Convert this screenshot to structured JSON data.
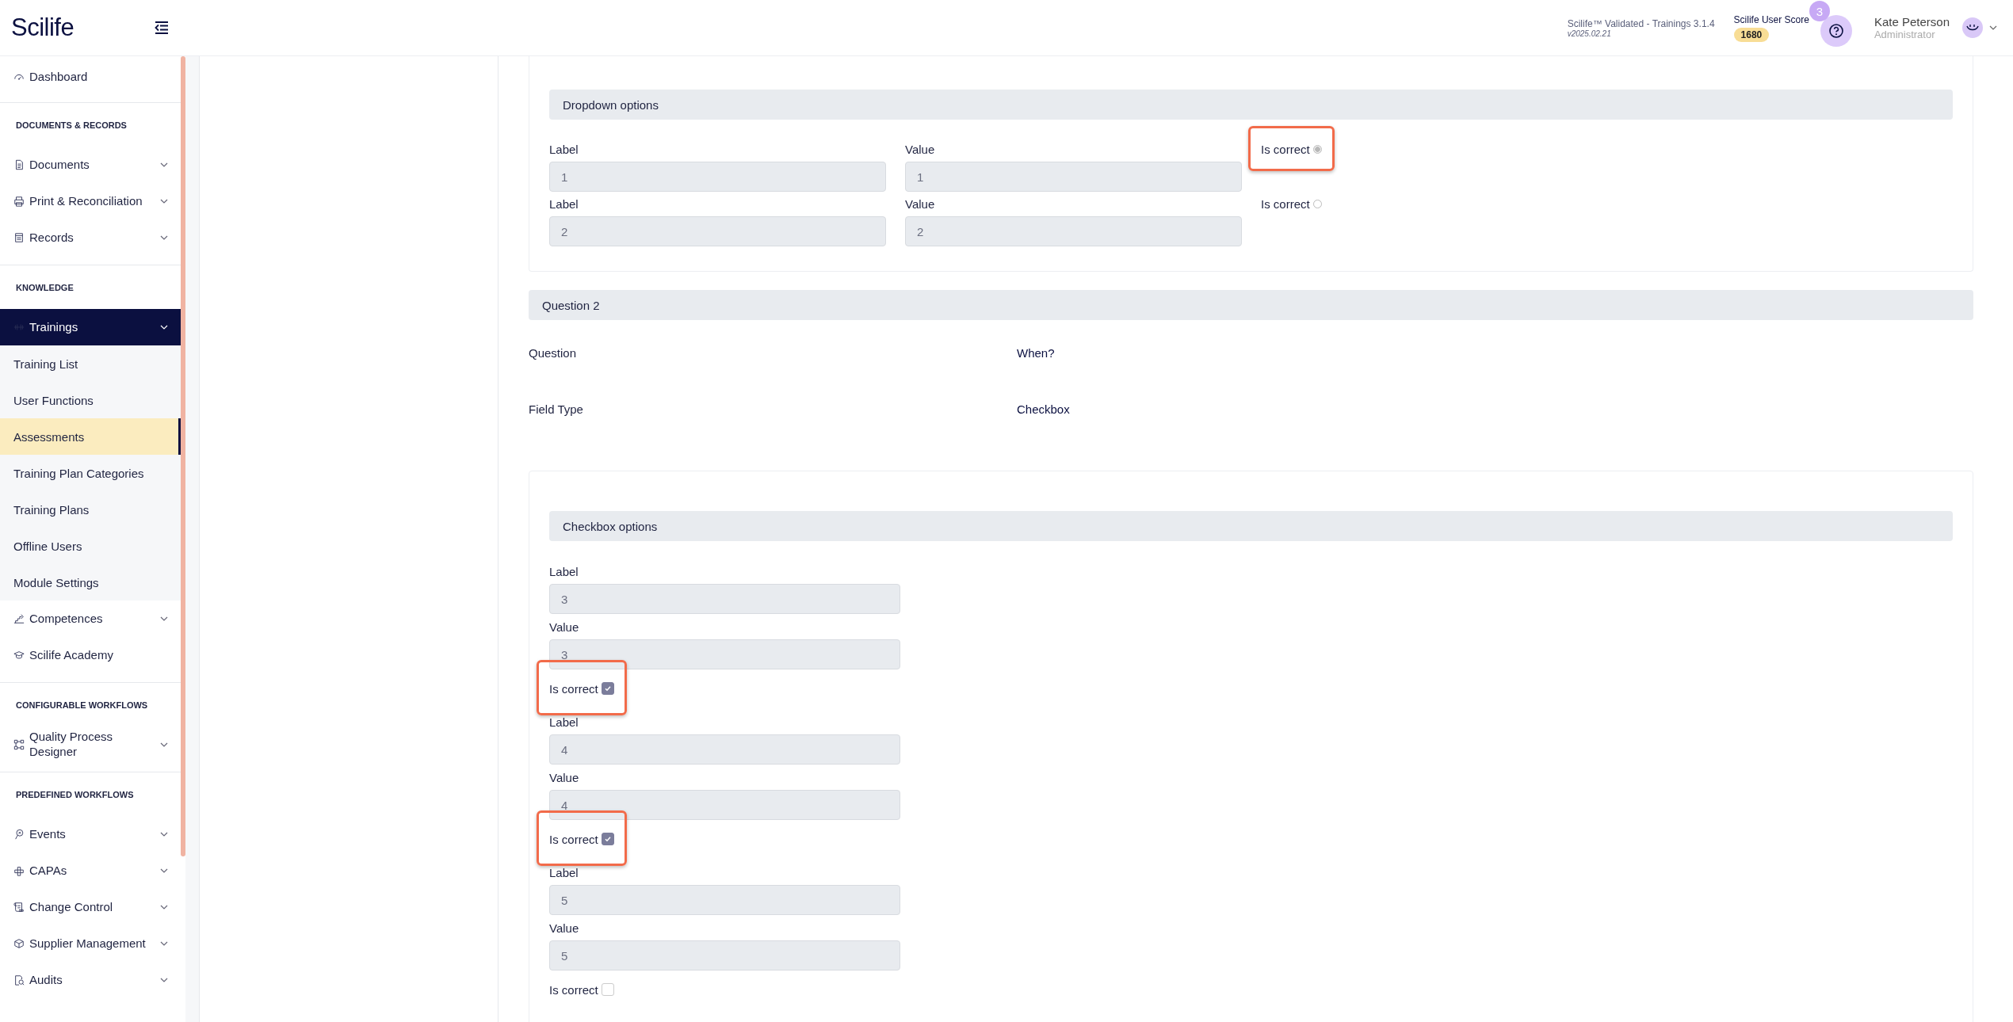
{
  "header": {
    "logo": "Scilife",
    "version_title": "Scilife™ Validated - Trainings 3.1.4",
    "version_number": "v2025.02.21",
    "score_label": "Scilife User Score",
    "score": "1680",
    "notification_count": "3",
    "user_name": "Kate Peterson",
    "user_role": "Administrator"
  },
  "sidebar": {
    "sections": [
      {
        "items": [
          {
            "label": "Dashboard",
            "expandable": false,
            "active": false
          }
        ]
      },
      {
        "heading": "DOCUMENTS & RECORDS",
        "items": [
          {
            "label": "Documents",
            "expandable": true,
            "active": false
          },
          {
            "label": "Print & Reconciliation",
            "expandable": true,
            "active": false
          },
          {
            "label": "Records",
            "expandable": true,
            "active": false
          }
        ]
      },
      {
        "heading": "KNOWLEDGE",
        "items": [
          {
            "label": "Trainings",
            "expandable": true,
            "active": true,
            "children": [
              {
                "label": "Training List",
                "selected": false
              },
              {
                "label": "User Functions",
                "selected": false
              },
              {
                "label": "Assessments",
                "selected": true
              },
              {
                "label": "Training Plan Categories",
                "selected": false
              },
              {
                "label": "Training Plans",
                "selected": false
              },
              {
                "label": "Offline Users",
                "selected": false
              },
              {
                "label": "Module Settings",
                "selected": false
              }
            ]
          },
          {
            "label": "Competences",
            "expandable": true,
            "active": false
          },
          {
            "label": "Scilife Academy",
            "expandable": false,
            "active": false
          }
        ]
      },
      {
        "heading": "CONFIGURABLE WORKFLOWS",
        "items": [
          {
            "label": "Quality Process Designer",
            "expandable": true,
            "active": false
          }
        ]
      },
      {
        "heading": "PREDEFINED WORKFLOWS",
        "items": [
          {
            "label": "Events",
            "expandable": true,
            "active": false
          },
          {
            "label": "CAPAs",
            "expandable": true,
            "active": false
          },
          {
            "label": "Change Control",
            "expandable": true,
            "active": false
          },
          {
            "label": "Supplier Management",
            "expandable": true,
            "active": false
          },
          {
            "label": "Audits",
            "expandable": true,
            "active": false
          }
        ]
      }
    ]
  },
  "dropdown_options": {
    "title": "Dropdown options",
    "options": [
      {
        "label_caption": "Label",
        "label": "1",
        "value_caption": "Value",
        "value": "1",
        "correct_caption": "Is correct",
        "selected": true,
        "highlighted": true
      },
      {
        "label_caption": "Label",
        "label": "2",
        "value_caption": "Value",
        "value": "2",
        "correct_caption": "Is correct",
        "selected": false,
        "highlighted": false
      }
    ]
  },
  "question": {
    "title": "Question 2",
    "fields": [
      {
        "name": "Question",
        "value": "When?"
      },
      {
        "name": "Field Type",
        "value": "Checkbox"
      }
    ]
  },
  "checkbox_options": {
    "title": "Checkbox options",
    "options": [
      {
        "label_caption": "Label",
        "label": "3",
        "value_caption": "Value",
        "value": "3",
        "correct_caption": "Is correct",
        "checked": true,
        "highlighted": true
      },
      {
        "label_caption": "Label",
        "label": "4",
        "value_caption": "Value",
        "value": "4",
        "correct_caption": "Is correct",
        "checked": true,
        "highlighted": true
      },
      {
        "label_caption": "Label",
        "label": "5",
        "value_caption": "Value",
        "value": "5",
        "correct_caption": "Is correct",
        "checked": false,
        "highlighted": false
      }
    ]
  }
}
